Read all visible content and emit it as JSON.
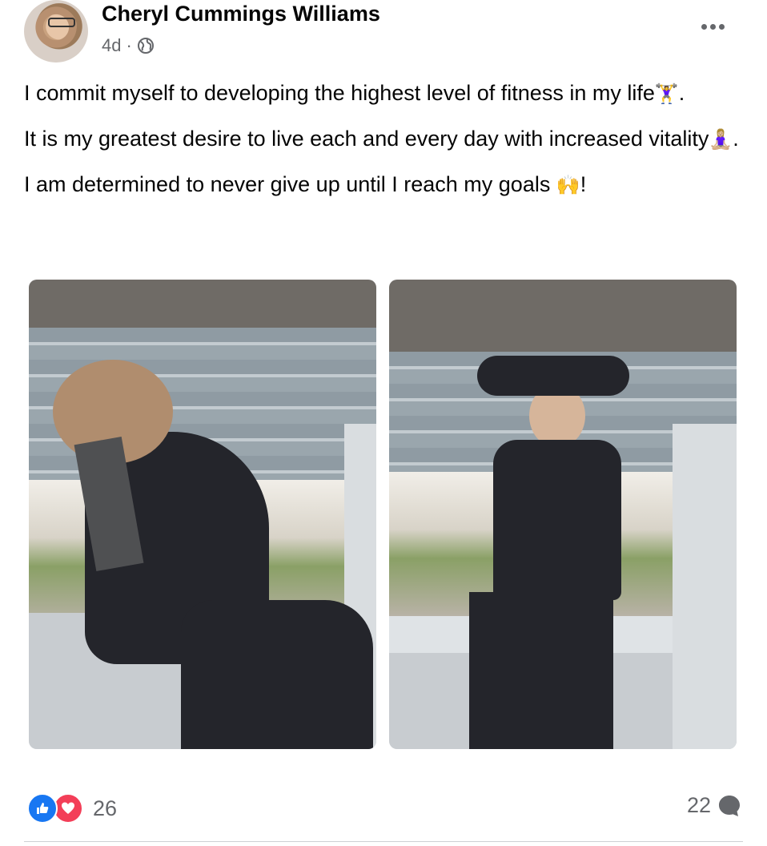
{
  "post": {
    "author": "Cheryl Cummings Williams",
    "time": "4d",
    "separator": "·",
    "audience_icon": "globe-icon",
    "more_icon": "more-options-icon",
    "paragraphs": [
      {
        "text": "I commit myself to developing the highest level of fitness in my life",
        "emoji": "🏋️‍♀️",
        "tail": "."
      },
      {
        "text": "It is my greatest desire to live each and every day with increased vitality",
        "emoji": "🧘🏼‍♀️",
        "tail": "."
      },
      {
        "text": "I am determined to never give up until I reach my goals ",
        "emoji": "🙌",
        "tail": "!"
      }
    ],
    "photos": [
      {
        "name": "photo-dumbbell-row"
      },
      {
        "name": "photo-overhead-extension"
      }
    ],
    "reactions": {
      "count": "26",
      "icons": [
        "like-icon",
        "love-icon"
      ],
      "colors": {
        "like": "#1877f2",
        "love": "#f33e58"
      }
    },
    "comments": {
      "count": "22",
      "icon": "comment-icon"
    }
  }
}
